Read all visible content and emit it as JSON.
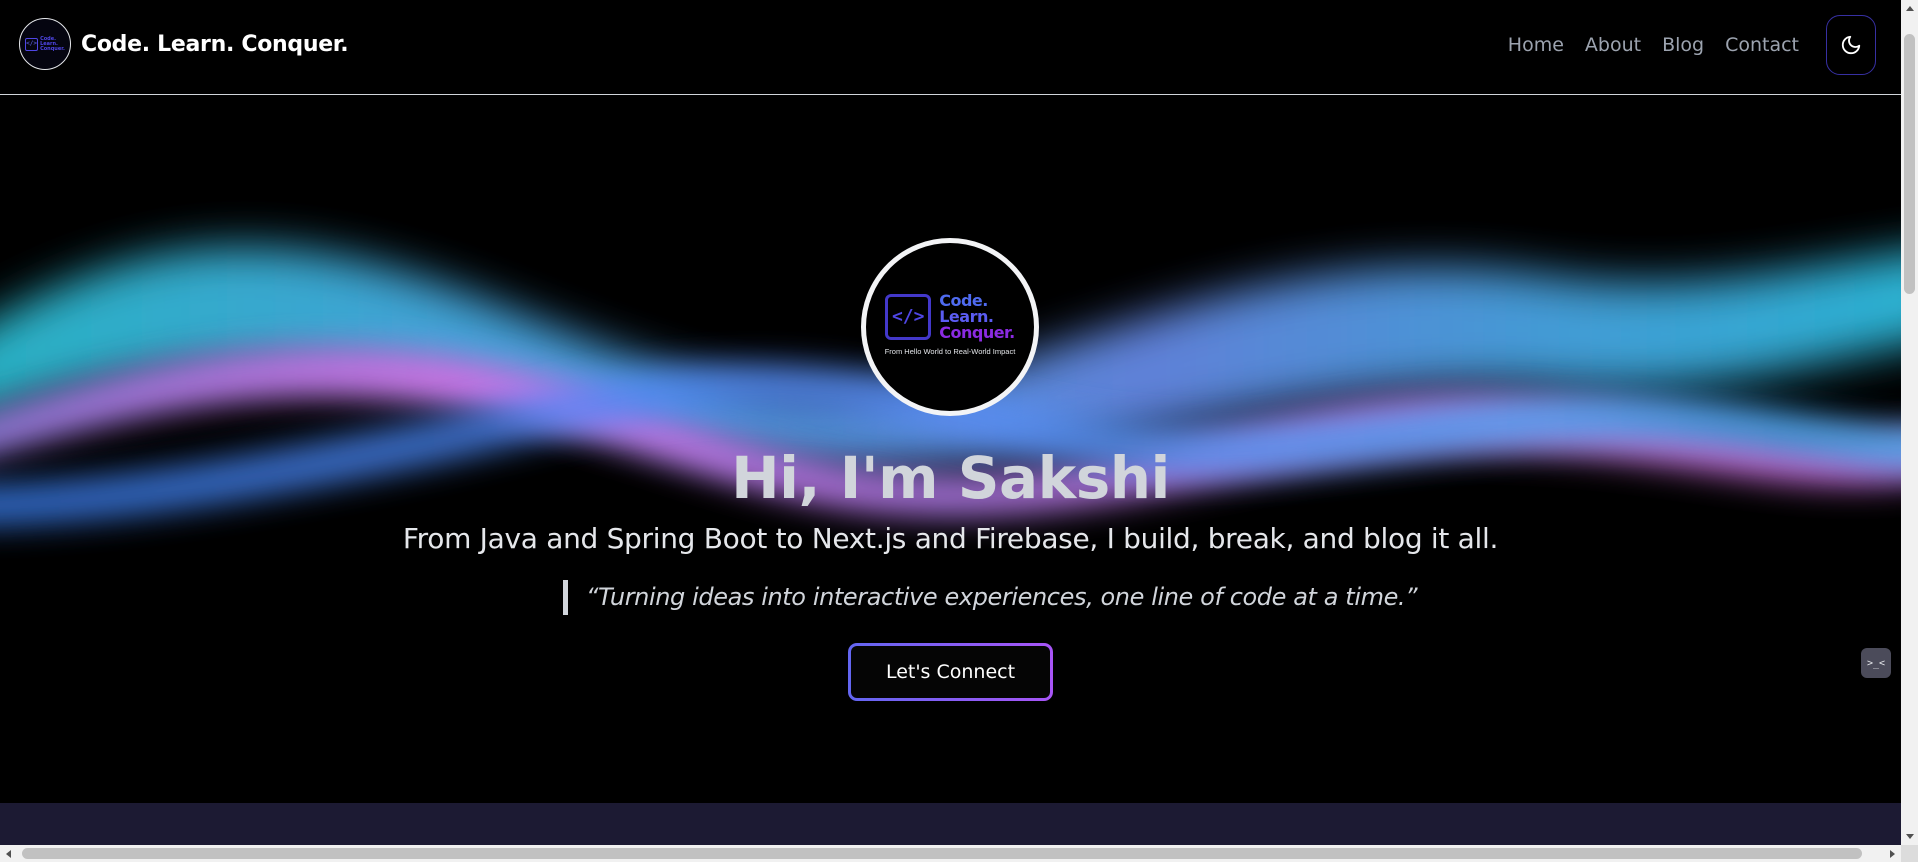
{
  "header": {
    "brand_title": "Code. Learn. Conquer.",
    "brand_logo_icon": "code-learn-conquer-logo",
    "nav": [
      {
        "label": "Home"
      },
      {
        "label": "About"
      },
      {
        "label": "Blog"
      },
      {
        "label": "Contact"
      }
    ],
    "theme_toggle_icon": "moon-icon"
  },
  "hero": {
    "avatar": {
      "code_symbol": "</>",
      "line1": "Code.",
      "line2": "Learn.",
      "line3": "Conquer.",
      "tagline": "From Hello World to Real-World Impact"
    },
    "title": "Hi, I'm Sakshi",
    "subtitle": "From Java and Spring Boot to Next.js and Firebase, I build, break, and blog it all.",
    "quote": "“Turning ideas into interactive experiences, one line of code at a time.”",
    "cta_label": "Let's Connect",
    "side_widget_icon": "terminal-face-icon",
    "side_widget_glyph": ">_<"
  },
  "colors": {
    "background": "#000000",
    "accent_indigo": "#6366f1",
    "accent_purple": "#a855f7",
    "wave_cyan": "#22c7e6",
    "wave_pink": "#d86ee8",
    "next_section_bg": "#1c1a33"
  }
}
